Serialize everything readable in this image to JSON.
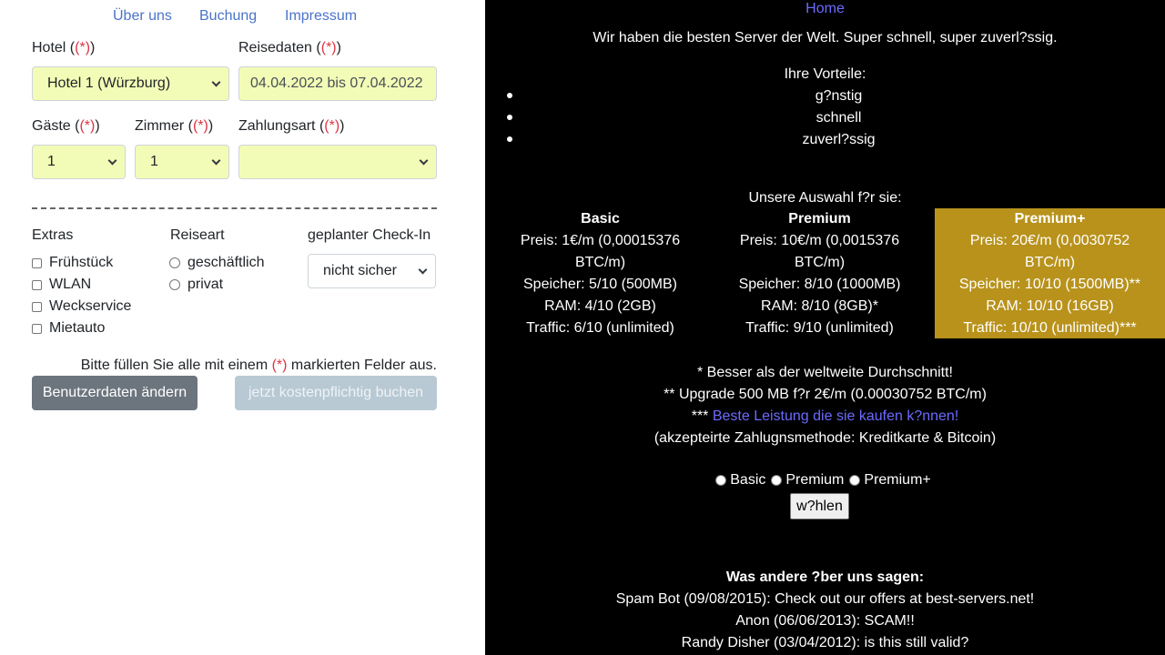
{
  "left": {
    "nav": [
      "Über uns",
      "Buchung",
      "Impressum"
    ],
    "hotel": {
      "label": "Hotel",
      "req": "(*)",
      "value": "Hotel 1 (Würzburg)"
    },
    "dates": {
      "label": "Reisedaten",
      "req": "(*)",
      "value": "04.04.2022 bis 07.04.2022"
    },
    "guests": {
      "label": "Gäste",
      "req": "(*)",
      "value": "1"
    },
    "rooms": {
      "label": "Zimmer",
      "req": "(*)",
      "value": "1"
    },
    "payment": {
      "label": "Zahlungsart",
      "req": "(*)",
      "value": ""
    },
    "extras": {
      "label": "Extras",
      "items": [
        "Frühstück",
        "WLAN",
        "Weckservice",
        "Mietauto"
      ]
    },
    "travel_type": {
      "label": "Reiseart",
      "items": [
        "geschäftlich",
        "privat"
      ]
    },
    "checkin": {
      "label": "geplanter Check-In",
      "value": "nicht sicher"
    },
    "hint": {
      "before": "Bitte füllen Sie alle mit einem ",
      "req": "(*)",
      "after": " markierten Felder aus."
    },
    "btn_change": "Benutzerdaten ändern",
    "btn_book": "jetzt kostenpflichtig buchen",
    "colors": {
      "link": "#4b73c9",
      "field": "#f3fcb6",
      "required": "#dc3545",
      "btn_dark": "#6c757d",
      "btn_disabled": "#b8c9d4"
    }
  },
  "right": {
    "home": "Home",
    "intro": "Wir haben die besten Server der Welt. Super schnell, super zuverl?ssig.",
    "benefits_title": "Ihre Vorteile:",
    "benefits": [
      "g?nstig",
      "schnell",
      "zuverl?ssig"
    ],
    "choice_title": "Unsere Auswahl f?r sie:",
    "plans": [
      {
        "name": "Basic",
        "lines": [
          "Preis: 1€/m (0,00015376",
          "BTC/m)",
          "Speicher: 5/10 (500MB)",
          "RAM: 4/10 (2GB)",
          "Traffic: 6/10 (unlimited)"
        ]
      },
      {
        "name": "Premium",
        "lines": [
          "Preis: 10€/m (0,0015376",
          "BTC/m)",
          "Speicher: 8/10 (1000MB)",
          "RAM: 8/10 (8GB)*",
          "Traffic: 9/10 (unlimited)"
        ]
      },
      {
        "name": "Premium+",
        "lines": [
          "Preis: 20€/m (0,0030752",
          "BTC/m)",
          "Speicher: 10/10 (1500MB)**",
          "RAM: 10/10 (16GB)",
          "Traffic: 10/10 (unlimited)***"
        ]
      }
    ],
    "note1": "* Besser als der weltweite Durchschnitt!",
    "note2": "** Upgrade 500 MB f?r 2€/m (0.00030752 BTC/m)",
    "note3_prefix": "*** ",
    "note3_link": "Beste Leistung die sie kaufen k?nnen!",
    "note4": "(akzepteirte Zahlugnsmethode: Kreditkarte & Bitcoin)",
    "radio_options": [
      "Basic",
      "Premium",
      "Premium+"
    ],
    "choose_btn": "w?hlen",
    "reviews_title": "Was andere ?ber uns sagen:",
    "reviews": [
      "Spam Bot (09/08/2015): Check out our offers at best-servers.net!",
      "Anon (06/06/2013): SCAM!!",
      "Randy Disher (03/04/2012): is this still valid?"
    ],
    "colors": {
      "background": "#000000",
      "highlight": "#b8921b",
      "link": "#6b6bff"
    }
  }
}
